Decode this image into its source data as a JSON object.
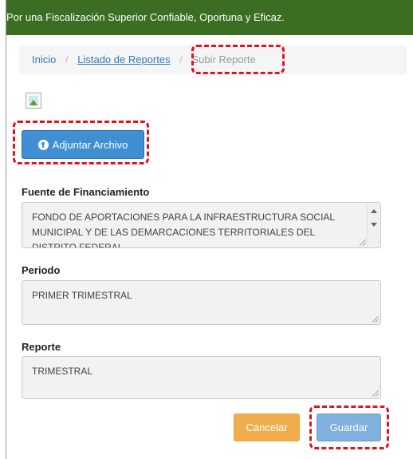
{
  "banner": {
    "text": "Por una Fiscalización Superior Confiable, Oportuna y Eficaz."
  },
  "breadcrumb": {
    "home": "Inicio",
    "separator": "/",
    "list": "Listado de Reportes",
    "current": "Subir Reporte"
  },
  "attach_button": {
    "label": "Adjuntar Archivo",
    "icon": "upload-circle-icon"
  },
  "fields": {
    "fuente": {
      "label": "Fuente de Financiamiento",
      "value": "FONDO DE APORTACIONES PARA LA INFRAESTRUCTURA SOCIAL MUNICIPAL Y DE LAS DEMARCACIONES TERRITORIALES DEL DISTRITO FEDERAL"
    },
    "periodo": {
      "label": "Periodo",
      "value": "PRIMER TRIMESTRAL"
    },
    "reporte": {
      "label": "Reporte",
      "value": "TRIMESTRAL"
    }
  },
  "actions": {
    "cancel": "Cancelar",
    "save": "Guardar"
  },
  "colors": {
    "banner": "#3b6e22",
    "highlight": "#e0141e",
    "primary": "#3f8fd2",
    "warning": "#f0ad4e"
  }
}
